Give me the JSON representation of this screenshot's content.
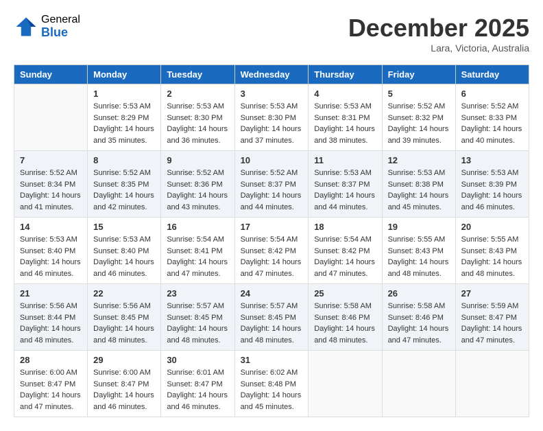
{
  "header": {
    "logo_general": "General",
    "logo_blue": "Blue",
    "month_title": "December 2025",
    "location": "Lara, Victoria, Australia"
  },
  "weekdays": [
    "Sunday",
    "Monday",
    "Tuesday",
    "Wednesday",
    "Thursday",
    "Friday",
    "Saturday"
  ],
  "weeks": [
    [
      {
        "day": "",
        "info": ""
      },
      {
        "day": "1",
        "info": "Sunrise: 5:53 AM\nSunset: 8:29 PM\nDaylight: 14 hours\nand 35 minutes."
      },
      {
        "day": "2",
        "info": "Sunrise: 5:53 AM\nSunset: 8:30 PM\nDaylight: 14 hours\nand 36 minutes."
      },
      {
        "day": "3",
        "info": "Sunrise: 5:53 AM\nSunset: 8:30 PM\nDaylight: 14 hours\nand 37 minutes."
      },
      {
        "day": "4",
        "info": "Sunrise: 5:53 AM\nSunset: 8:31 PM\nDaylight: 14 hours\nand 38 minutes."
      },
      {
        "day": "5",
        "info": "Sunrise: 5:52 AM\nSunset: 8:32 PM\nDaylight: 14 hours\nand 39 minutes."
      },
      {
        "day": "6",
        "info": "Sunrise: 5:52 AM\nSunset: 8:33 PM\nDaylight: 14 hours\nand 40 minutes."
      }
    ],
    [
      {
        "day": "7",
        "info": "Sunrise: 5:52 AM\nSunset: 8:34 PM\nDaylight: 14 hours\nand 41 minutes."
      },
      {
        "day": "8",
        "info": "Sunrise: 5:52 AM\nSunset: 8:35 PM\nDaylight: 14 hours\nand 42 minutes."
      },
      {
        "day": "9",
        "info": "Sunrise: 5:52 AM\nSunset: 8:36 PM\nDaylight: 14 hours\nand 43 minutes."
      },
      {
        "day": "10",
        "info": "Sunrise: 5:52 AM\nSunset: 8:37 PM\nDaylight: 14 hours\nand 44 minutes."
      },
      {
        "day": "11",
        "info": "Sunrise: 5:53 AM\nSunset: 8:37 PM\nDaylight: 14 hours\nand 44 minutes."
      },
      {
        "day": "12",
        "info": "Sunrise: 5:53 AM\nSunset: 8:38 PM\nDaylight: 14 hours\nand 45 minutes."
      },
      {
        "day": "13",
        "info": "Sunrise: 5:53 AM\nSunset: 8:39 PM\nDaylight: 14 hours\nand 46 minutes."
      }
    ],
    [
      {
        "day": "14",
        "info": "Sunrise: 5:53 AM\nSunset: 8:40 PM\nDaylight: 14 hours\nand 46 minutes."
      },
      {
        "day": "15",
        "info": "Sunrise: 5:53 AM\nSunset: 8:40 PM\nDaylight: 14 hours\nand 46 minutes."
      },
      {
        "day": "16",
        "info": "Sunrise: 5:54 AM\nSunset: 8:41 PM\nDaylight: 14 hours\nand 47 minutes."
      },
      {
        "day": "17",
        "info": "Sunrise: 5:54 AM\nSunset: 8:42 PM\nDaylight: 14 hours\nand 47 minutes."
      },
      {
        "day": "18",
        "info": "Sunrise: 5:54 AM\nSunset: 8:42 PM\nDaylight: 14 hours\nand 47 minutes."
      },
      {
        "day": "19",
        "info": "Sunrise: 5:55 AM\nSunset: 8:43 PM\nDaylight: 14 hours\nand 48 minutes."
      },
      {
        "day": "20",
        "info": "Sunrise: 5:55 AM\nSunset: 8:43 PM\nDaylight: 14 hours\nand 48 minutes."
      }
    ],
    [
      {
        "day": "21",
        "info": "Sunrise: 5:56 AM\nSunset: 8:44 PM\nDaylight: 14 hours\nand 48 minutes."
      },
      {
        "day": "22",
        "info": "Sunrise: 5:56 AM\nSunset: 8:45 PM\nDaylight: 14 hours\nand 48 minutes."
      },
      {
        "day": "23",
        "info": "Sunrise: 5:57 AM\nSunset: 8:45 PM\nDaylight: 14 hours\nand 48 minutes."
      },
      {
        "day": "24",
        "info": "Sunrise: 5:57 AM\nSunset: 8:45 PM\nDaylight: 14 hours\nand 48 minutes."
      },
      {
        "day": "25",
        "info": "Sunrise: 5:58 AM\nSunset: 8:46 PM\nDaylight: 14 hours\nand 48 minutes."
      },
      {
        "day": "26",
        "info": "Sunrise: 5:58 AM\nSunset: 8:46 PM\nDaylight: 14 hours\nand 47 minutes."
      },
      {
        "day": "27",
        "info": "Sunrise: 5:59 AM\nSunset: 8:47 PM\nDaylight: 14 hours\nand 47 minutes."
      }
    ],
    [
      {
        "day": "28",
        "info": "Sunrise: 6:00 AM\nSunset: 8:47 PM\nDaylight: 14 hours\nand 47 minutes."
      },
      {
        "day": "29",
        "info": "Sunrise: 6:00 AM\nSunset: 8:47 PM\nDaylight: 14 hours\nand 46 minutes."
      },
      {
        "day": "30",
        "info": "Sunrise: 6:01 AM\nSunset: 8:47 PM\nDaylight: 14 hours\nand 46 minutes."
      },
      {
        "day": "31",
        "info": "Sunrise: 6:02 AM\nSunset: 8:48 PM\nDaylight: 14 hours\nand 45 minutes."
      },
      {
        "day": "",
        "info": ""
      },
      {
        "day": "",
        "info": ""
      },
      {
        "day": "",
        "info": ""
      }
    ]
  ]
}
